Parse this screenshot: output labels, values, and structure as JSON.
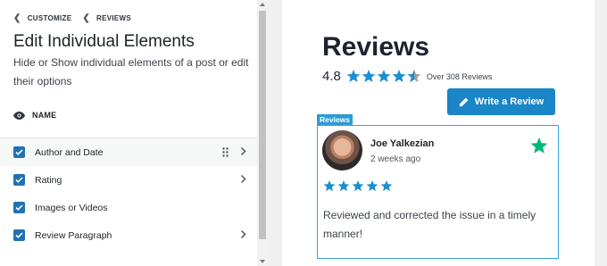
{
  "breadcrumb": {
    "customize": "CUSTOMIZE",
    "reviews": "REVIEWS"
  },
  "panel": {
    "title": "Edit Individual Elements",
    "description": "Hide or Show individual elements of a post or edit their options",
    "section_label": "NAME",
    "items": [
      {
        "label": "Author and Date",
        "checked": true,
        "has_drag": true,
        "has_arrow": true
      },
      {
        "label": "Rating",
        "checked": true,
        "has_drag": false,
        "has_arrow": true
      },
      {
        "label": "Images or Videos",
        "checked": true,
        "has_drag": false,
        "has_arrow": false
      },
      {
        "label": "Review Paragraph",
        "checked": true,
        "has_drag": false,
        "has_arrow": true
      }
    ]
  },
  "preview": {
    "title": "Reviews",
    "rating": "4.8",
    "review_count": "Over 308 Reviews",
    "write_button": "Write a Review",
    "tag": "Reviews",
    "review": {
      "author": "Joe Yalkezian",
      "date": "2 weeks ago",
      "stars": 5,
      "text": "Reviewed and corrected the issue in a timely manner!"
    }
  },
  "colors": {
    "accent": "#1a85c7",
    "star": "#1a8fd2",
    "checkbox": "#2271b1",
    "trustpilot": "#00b67a"
  }
}
